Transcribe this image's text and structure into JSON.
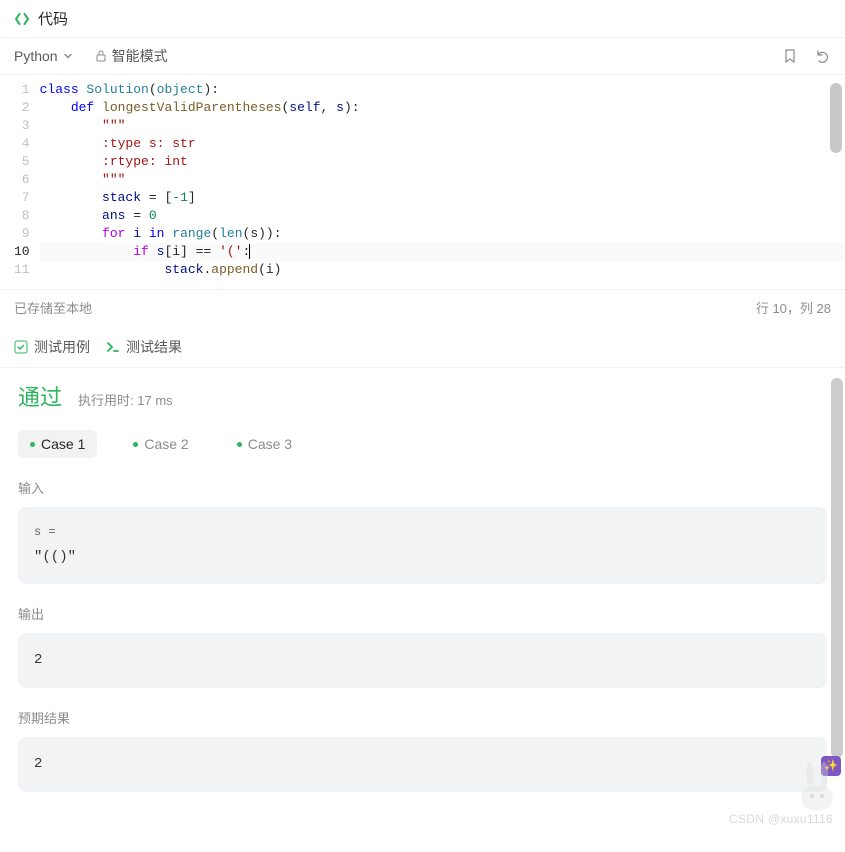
{
  "header": {
    "title": "代码"
  },
  "toolbar": {
    "language": "Python",
    "mode": "智能模式",
    "bookmark_icon": "bookmark",
    "undo_icon": "undo"
  },
  "editor": {
    "current_line": 10,
    "lines_numbers": [
      "1",
      "2",
      "3",
      "4",
      "5",
      "6",
      "7",
      "8",
      "9",
      "10",
      "11"
    ],
    "code_tokens": {
      "l1": [
        {
          "t": "class ",
          "c": "kw-class"
        },
        {
          "t": "Solution",
          "c": "cls"
        },
        {
          "t": "(",
          "c": ""
        },
        {
          "t": "object",
          "c": "kw-builtin"
        },
        {
          "t": "):",
          "c": ""
        }
      ],
      "l2": [
        {
          "t": "    ",
          "c": ""
        },
        {
          "t": "def ",
          "c": "kw-def"
        },
        {
          "t": "longestValidParentheses",
          "c": "fun"
        },
        {
          "t": "(",
          "c": ""
        },
        {
          "t": "self",
          "c": "obj"
        },
        {
          "t": ", ",
          "c": ""
        },
        {
          "t": "s",
          "c": "obj"
        },
        {
          "t": "):",
          "c": ""
        }
      ],
      "l3": [
        {
          "t": "        ",
          "c": ""
        },
        {
          "t": "\"\"\"",
          "c": "cmt"
        }
      ],
      "l4": [
        {
          "t": "        :type s: str",
          "c": "cmt"
        }
      ],
      "l5": [
        {
          "t": "        :rtype: int",
          "c": "cmt"
        }
      ],
      "l6": [
        {
          "t": "        ",
          "c": ""
        },
        {
          "t": "\"\"\"",
          "c": "cmt"
        }
      ],
      "l7": [
        {
          "t": "        ",
          "c": ""
        },
        {
          "t": "stack",
          "c": "obj"
        },
        {
          "t": " = [",
          "c": ""
        },
        {
          "t": "-1",
          "c": "num"
        },
        {
          "t": "]",
          "c": ""
        }
      ],
      "l8": [
        {
          "t": "        ",
          "c": ""
        },
        {
          "t": "ans",
          "c": "obj"
        },
        {
          "t": " = ",
          "c": ""
        },
        {
          "t": "0",
          "c": "num"
        }
      ],
      "l9": [
        {
          "t": "        ",
          "c": ""
        },
        {
          "t": "for ",
          "c": "kw-flow"
        },
        {
          "t": "i",
          "c": "obj"
        },
        {
          "t": " ",
          "c": ""
        },
        {
          "t": "in ",
          "c": "opk"
        },
        {
          "t": "range",
          "c": "kw-builtin"
        },
        {
          "t": "(",
          "c": ""
        },
        {
          "t": "len",
          "c": "kw-builtin"
        },
        {
          "t": "(s)):",
          "c": ""
        }
      ],
      "l10": [
        {
          "t": "            ",
          "c": ""
        },
        {
          "t": "if ",
          "c": "kw-flow"
        },
        {
          "t": "s",
          "c": "obj"
        },
        {
          "t": "[i] == ",
          "c": ""
        },
        {
          "t": "'('",
          "c": "str"
        },
        {
          "t": ":",
          "c": ""
        }
      ],
      "l11": [
        {
          "t": "                ",
          "c": ""
        },
        {
          "t": "stack",
          "c": "obj"
        },
        {
          "t": ".",
          "c": ""
        },
        {
          "t": "append",
          "c": "fun"
        },
        {
          "t": "(i)",
          "c": ""
        }
      ]
    }
  },
  "status": {
    "saved": "已存储至本地",
    "position": "行 10，列 28"
  },
  "tabs": {
    "test_cases": "测试用例",
    "test_result": "测试结果"
  },
  "result": {
    "pass": "通过",
    "runtime_label": "执行用时:",
    "runtime_value": "17 ms",
    "cases": [
      {
        "label": "Case 1",
        "active": true
      },
      {
        "label": "Case 2",
        "active": false
      },
      {
        "label": "Case 3",
        "active": false
      }
    ],
    "input_label": "输入",
    "input_var": "s =",
    "input_value": "\"(()\"",
    "output_label": "输出",
    "output_value": "2",
    "expected_label": "预期结果",
    "expected_value": "2"
  },
  "watermark": "CSDN @xuxu1116"
}
